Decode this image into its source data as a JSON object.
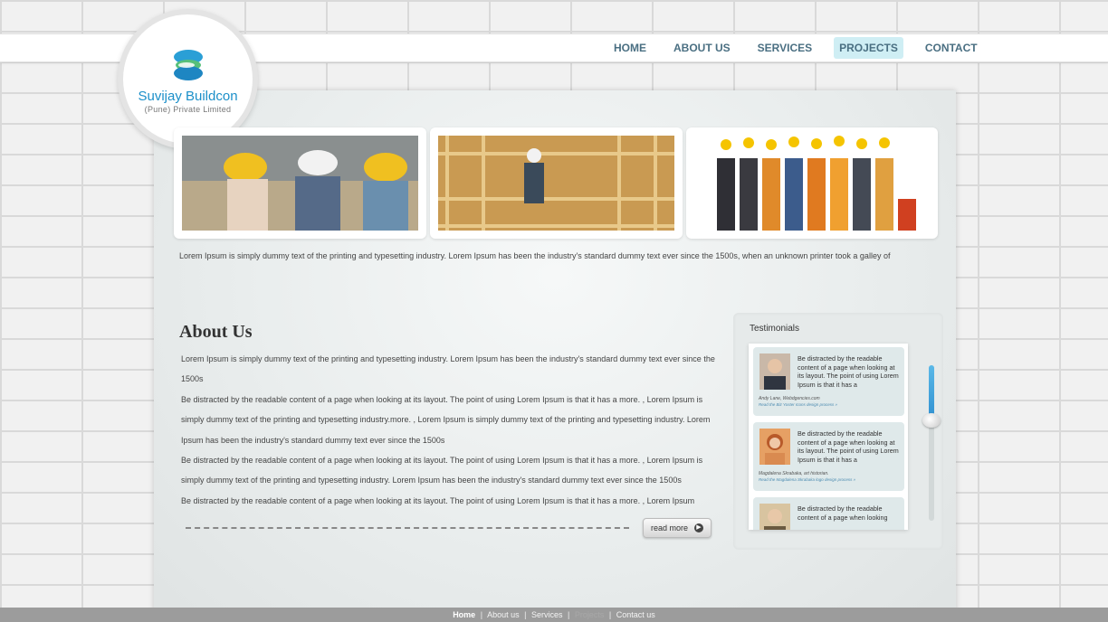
{
  "nav": {
    "items": [
      {
        "label": "HOME"
      },
      {
        "label": "ABOUT US"
      },
      {
        "label": "SERVICES"
      },
      {
        "label": "PROJECTS"
      },
      {
        "label": "CONTACT"
      }
    ],
    "active": "PROJECTS"
  },
  "logo": {
    "name": "Suvijay Buildcon",
    "subtitle": "(Pune) Private Limited"
  },
  "intro_text": "Lorem Ipsum is simply dummy text of the printing and typesetting industry. Lorem Ipsum has been the industry's standard dummy text ever since the 1500s, when an unknown printer took a galley of",
  "about": {
    "title": "About Us",
    "paragraph_1": "Lorem Ipsum is simply dummy text of the printing and typesetting industry. Lorem Ipsum has been the industry's standard dummy text ever since the 1500s",
    "paragraph_2": "Be distracted by the readable content of a page when looking at its layout. The point of using Lorem Ipsum is that it has a more. , Lorem Ipsum is simply dummy text of the printing and typesetting industry.more. , Lorem Ipsum is simply dummy text of the printing and typesetting industry. Lorem Ipsum has been the industry's standard dummy text ever since the 1500s",
    "paragraph_3": "Be distracted by the readable content of a page when looking at its layout. The point of using Lorem Ipsum is that it has a more. , Lorem Ipsum is simply dummy text of the printing and typesetting industry. Lorem Ipsum has been the industry's standard dummy text ever since the 1500s",
    "paragraph_4": "Be distracted by the readable content of a page when looking at its layout. The point of using Lorem Ipsum is that it has a more. , Lorem Ipsum",
    "read_more_label": "read more"
  },
  "testimonials": {
    "title": "Testimonials",
    "items": [
      {
        "quote": "Be distracted by the readable content of a page when looking at its layout. The point of using Lorem Ipsum is that it has a",
        "author": "Andy Lane, Webdgencies.com",
        "project": "Read the Biz Yoster Icons design process »"
      },
      {
        "quote": "Be distracted by the readable content of a page when looking at its layout. The point of using Lorem Ipsum is that it has a",
        "author": "Magdalena Skrabaka, art historian.",
        "project": "Read the Magdalena Skrabaka logo design process »"
      },
      {
        "quote": "Be distracted by the readable content of a page when looking",
        "author": "",
        "project": ""
      }
    ],
    "scroll_position": 0.3
  },
  "footer": {
    "home": "Home",
    "about": "About us",
    "services": "Services",
    "projects": "Projects",
    "contact": "Contact us",
    "separator": "|"
  },
  "colors": {
    "accent": "#1b8fc9",
    "nav_text": "#4a6f82",
    "nav_active_bg": "#cfeef4",
    "footer_bg": "#9c9c9c"
  },
  "icons": {
    "logo": "logo-mark-icon",
    "read_more": "arrow-right-icon",
    "scroll_knob": "scroll-knob-icon"
  }
}
